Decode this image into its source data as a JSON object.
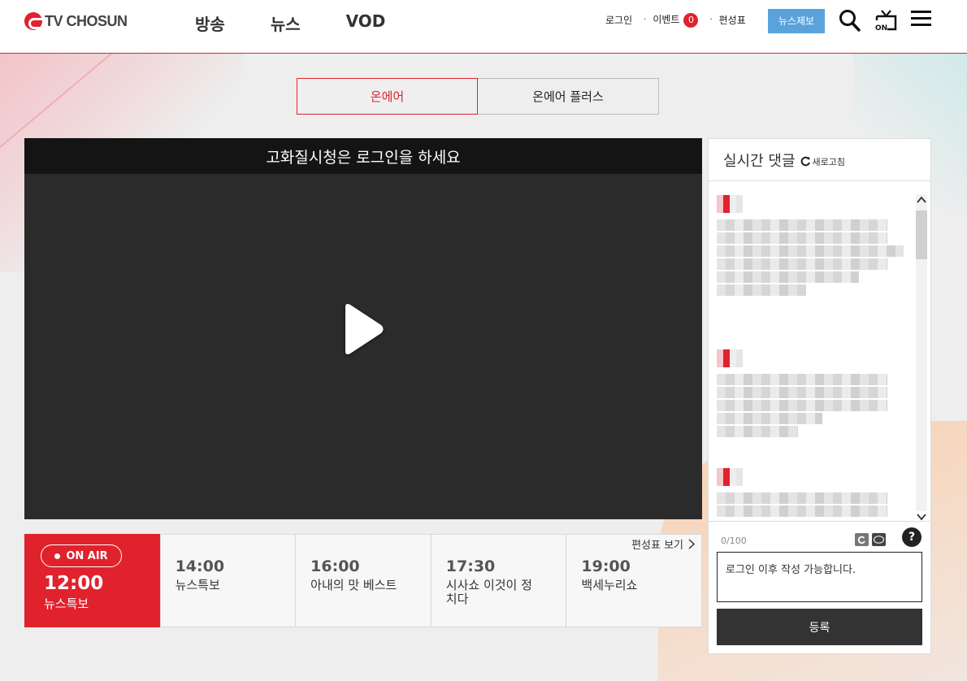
{
  "header": {
    "logo_text": "TV CHOSUN",
    "nav": [
      "방송",
      "뉴스",
      "VOD"
    ],
    "util": {
      "login": "로그인",
      "event": "이벤트",
      "event_count": "0",
      "schedule": "편성표"
    },
    "news_tip": "뉴스제보",
    "icons": [
      "search-icon",
      "tv-on-icon",
      "menu-icon"
    ]
  },
  "tabs": [
    {
      "label": "온에어",
      "active": true
    },
    {
      "label": "온에어 플러스",
      "active": false
    }
  ],
  "player": {
    "notice": "고화질시청은 로그인을 하세요"
  },
  "schedule": {
    "link_label": "편성표 보기",
    "now": {
      "badge": "ON AIR",
      "time": "12:00",
      "title": "뉴스특보"
    },
    "items": [
      {
        "time": "14:00",
        "title": "뉴스특보"
      },
      {
        "time": "16:00",
        "title": "아내의 맛 베스트"
      },
      {
        "time": "17:30",
        "title": "시사쇼 이것이 정치다"
      },
      {
        "time": "19:00",
        "title": "백세누리쇼"
      }
    ]
  },
  "chat": {
    "title": "실시간 댓글",
    "refresh_label": "새로고침",
    "count": "0/100",
    "help": "?",
    "input_placeholder": "로그인 이후 작성 가능합니다.",
    "submit_label": "등록"
  },
  "colors": {
    "accent": "#e0222d",
    "news_tip": "#5aa2dc",
    "dark": "#333333"
  }
}
